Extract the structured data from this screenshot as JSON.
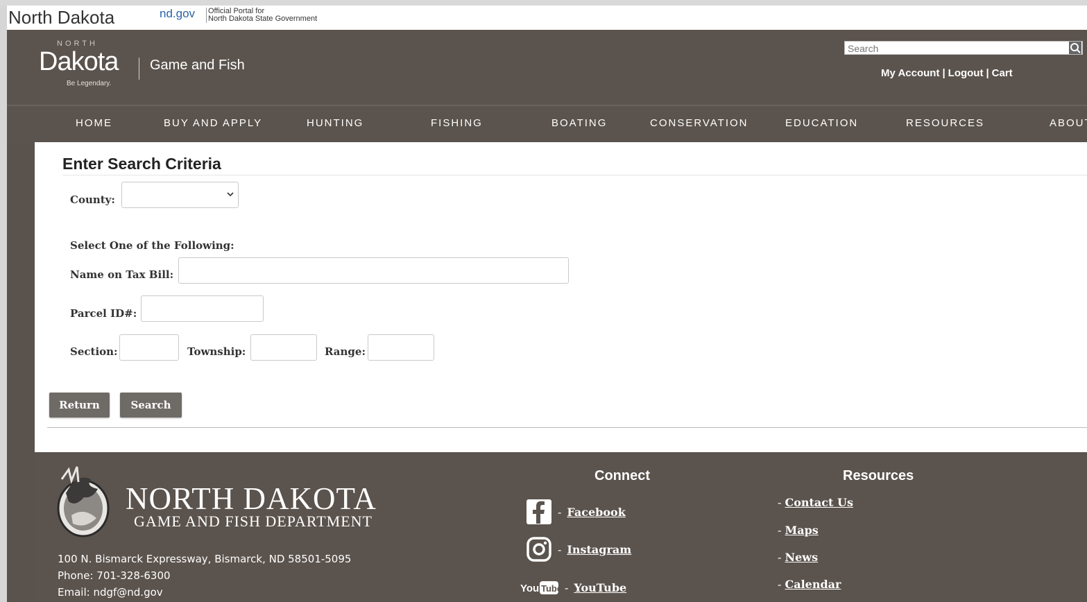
{
  "portal": {
    "site_name": "North Dakota",
    "ndgov": "nd.gov",
    "portal_line1": "Official Portal for",
    "portal_line2": "North Dakota State Government"
  },
  "header": {
    "brand_north": "NORTH",
    "brand_dakota": "Dakota",
    "brand_tagline": "Be Legendary.",
    "department": "Game and Fish",
    "search_placeholder": "Search",
    "links": [
      "My Account",
      "Logout",
      "Cart"
    ],
    "separator": "|"
  },
  "nav": {
    "items": [
      "HOME",
      "BUY AND APPLY",
      "HUNTING",
      "FISHING",
      "BOATING",
      "CONSERVATION",
      "EDUCATION",
      "RESOURCES",
      "ABOUT"
    ]
  },
  "form": {
    "title": "Enter Search Criteria",
    "county_label": "County:",
    "county_value": "",
    "select_one": "Select One of the Following:",
    "name_label": "Name on Tax Bill:",
    "name_value": "",
    "parcel_label": "Parcel ID#:",
    "parcel_value": "",
    "section_label": "Section:",
    "township_label": "Township:",
    "range_label": "Range:",
    "return_button": "Return",
    "search_button": "Search"
  },
  "footer": {
    "logo_line1": "NORTH DAKOTA",
    "logo_line2": "GAME AND FISH DEPARTMENT",
    "address": "100 N. Bismarck Expressway, Bismarck, ND 58501-5095",
    "phone": "Phone: 701-328-6300",
    "email": "Email: ndgf@nd.gov",
    "connect_heading": "Connect",
    "social": [
      {
        "label": "Facebook",
        "icon": "facebook-icon"
      },
      {
        "label": "Instagram",
        "icon": "instagram-icon"
      },
      {
        "label": "YouTube",
        "icon": "youtube-icon"
      }
    ],
    "resources_heading": "Resources",
    "resources": [
      "Contact Us",
      "Maps",
      "News",
      "Calendar"
    ],
    "dash": "-"
  }
}
